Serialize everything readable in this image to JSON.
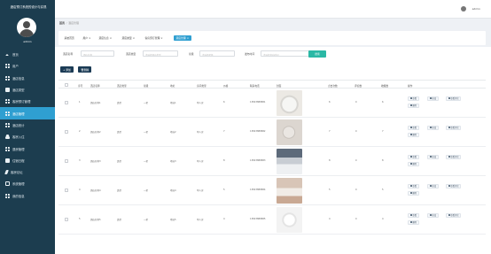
{
  "app": {
    "title": "酒店预订系统的设计与实现",
    "user": "admin"
  },
  "sidebar": {
    "items": [
      {
        "label": "首页",
        "icon": "home-icon"
      },
      {
        "label": "用户",
        "icon": "grid-icon"
      },
      {
        "label": "酒店信息",
        "icon": "grid-icon"
      },
      {
        "label": "酒店类型",
        "icon": "square-icon"
      },
      {
        "label": "客房预订管理",
        "icon": "grid-icon"
      },
      {
        "label": "酒店管理",
        "icon": "grid-icon",
        "active": true
      },
      {
        "label": "酒店统计",
        "icon": "grid-icon"
      },
      {
        "label": "客房入住",
        "icon": "person-icon"
      },
      {
        "label": "退房管理",
        "icon": "grid-icon"
      },
      {
        "label": "住宿日程",
        "icon": "chat-icon"
      },
      {
        "label": "客房论坛",
        "icon": "bolt-icon"
      },
      {
        "label": "系统管理",
        "icon": "gear-icon"
      },
      {
        "label": "我的信息",
        "icon": "grid-icon"
      }
    ]
  },
  "breadcrumb": {
    "home": "首页",
    "current": "酒店管理"
  },
  "tabs": [
    {
      "label": "系统首页"
    },
    {
      "label": "用户",
      "closable": true
    },
    {
      "label": "酒店信息",
      "closable": true
    },
    {
      "label": "酒店类型",
      "closable": true
    },
    {
      "label": "客房预订管理",
      "closable": true
    },
    {
      "label": "酒店管理",
      "closable": true,
      "active": true
    }
  ],
  "search": {
    "fields": [
      {
        "label": "酒店名称",
        "placeholder": "酒店名称"
      },
      {
        "label": "酒店类型",
        "placeholder": "请选择酒店类型"
      },
      {
        "label": "星级",
        "placeholder": "请选择星级"
      },
      {
        "label": "发布时间",
        "placeholder": "请选择发布时间"
      }
    ],
    "button": "搜索"
  },
  "toolbar": {
    "add": "+ 添加",
    "delete": "删除"
  },
  "table": {
    "columns": [
      "序号",
      "酒店名称",
      "酒店类型",
      "星级",
      "地址",
      "房间类型",
      "价格",
      "联系电话",
      "封面",
      "点击次数",
      "评论数",
      "收藏数",
      "操作"
    ],
    "rows": [
      {
        "idx": "1",
        "name": "酒店名称1",
        "type": "类型",
        "star": "一星",
        "addr": "地址1",
        "room": "单人房",
        "price": "6",
        "phone": "13823888881",
        "clicks": "6",
        "comments": "0",
        "favs": "6"
      },
      {
        "idx": "2",
        "name": "酒店名称2",
        "type": "类型",
        "star": "一星",
        "addr": "地址2",
        "room": "单人房",
        "price": "7",
        "phone": "13823888882",
        "clicks": "7",
        "comments": "0",
        "favs": "7"
      },
      {
        "idx": "3",
        "name": "酒店名称3",
        "type": "类型",
        "star": "一星",
        "addr": "地址3",
        "room": "单人房",
        "price": "8",
        "phone": "13823888883",
        "clicks": "8",
        "comments": "0",
        "favs": "8"
      },
      {
        "idx": "4",
        "name": "酒店名称4",
        "type": "类型",
        "star": "一星",
        "addr": "地址4",
        "room": "单人房",
        "price": "5",
        "phone": "13823888884",
        "clicks": "5",
        "comments": "0",
        "favs": "5"
      },
      {
        "idx": "5",
        "name": "酒店名称5",
        "type": "类型",
        "star": "一星",
        "addr": "地址5",
        "room": "单人房",
        "price": "4",
        "phone": "13823888885",
        "clicks": "4",
        "comments": "0",
        "favs": "4"
      }
    ],
    "actions": {
      "view": "查看",
      "edit": "修改",
      "review": "查看评论",
      "del": "删除"
    }
  }
}
